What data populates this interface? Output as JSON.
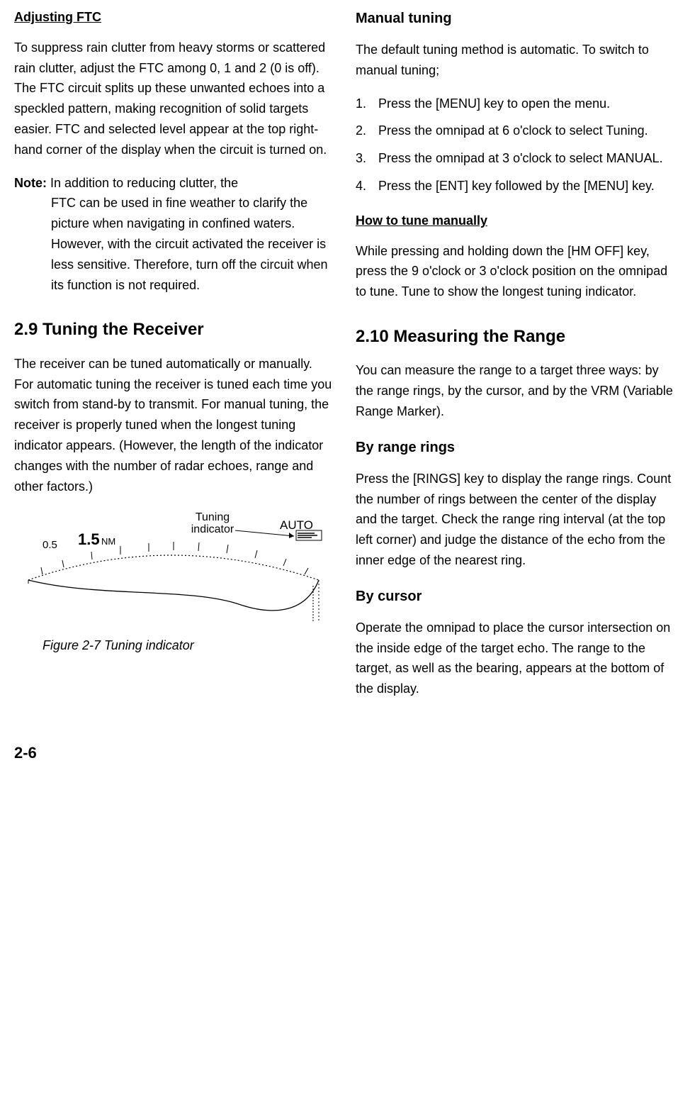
{
  "left": {
    "h_ftc": "Adjusting FTC",
    "p_ftc": "To suppress rain clutter from heavy storms or scattered rain clutter, adjust the FTC among 0, 1 and 2 (0 is off). The FTC circuit splits up these unwanted echoes into a speckled pattern, making recognition of solid targets easier. FTC and selected level appear at the top right-hand corner of the display when the circuit is turned on.",
    "note_label": "Note:",
    "note_first": " In addition to reducing clutter, the",
    "note_rest": "FTC can be used in fine weather to clarify the picture when navigating in confined waters. However, with the circuit activated the receiver is less sensitive. Therefore, turn off the circuit when its function is not required.",
    "h_29": "2.9 Tuning the Receiver",
    "p_29": "The receiver can be tuned automatically or manually. For automatic tuning the receiver is tuned each time you switch from stand-by to transmit. For manual tuning, the receiver is properly tuned when the longest tuning indicator appears. (However, the length of the indicator changes with the number of radar echoes, range and other factors.)",
    "fig": {
      "interval": "0.5",
      "range": "1.5",
      "unit": "NM",
      "tuning_lbl1": "Tuning",
      "tuning_lbl2": "indicator",
      "auto": "AUTO",
      "caption": "Figure 2-7 Tuning indicator"
    }
  },
  "right": {
    "h_manual": "Manual tuning",
    "p_manual": "The default tuning method is automatic. To switch to manual tuning;",
    "steps": [
      "Press the [MENU] key to open the menu.",
      "Press the omnipad at 6 o'clock to select Tuning.",
      "Press the omnipad at 3 o'clock to select MANUAL.",
      "Press the [ENT] key followed by the [MENU] key."
    ],
    "h_howto": "How to tune manually",
    "p_howto": "While pressing and holding down the [HM OFF] key, press the 9 o'clock or 3 o'clock position on the omnipad to tune. Tune to show the longest tuning indicator.",
    "h_210": "2.10 Measuring the Range",
    "p_210": "You can measure the range to a target three ways: by the range rings, by the cursor, and by the VRM (Variable Range Marker).",
    "h_rings": "By range rings",
    "p_rings": "Press the [RINGS] key to display the range rings. Count the number of rings between the center of the display and the target. Check the range ring interval (at the top left corner) and judge the distance of the echo from the inner edge of the nearest ring.",
    "h_cursor": "By cursor",
    "p_cursor": "Operate the omnipad to place the cursor intersection on the inside edge of the target echo. The range to the target, as well as the bearing, appears at the bottom of the display."
  },
  "page": "2-6"
}
